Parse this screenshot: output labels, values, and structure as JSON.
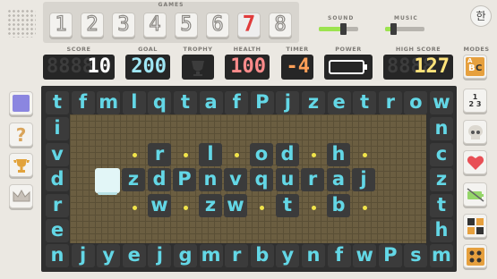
{
  "header": {
    "games_label": "GAMES",
    "games": [
      "1",
      "2",
      "3",
      "4",
      "5",
      "6",
      "7",
      "8"
    ],
    "active_game": "7",
    "sound_label": "SOUND",
    "music_label": "MUSIC",
    "sound_level": 0.62,
    "music_level": 0.2,
    "lang_button": "한"
  },
  "stats": {
    "score": {
      "label": "SCORE",
      "value": "10",
      "ghost": "8888",
      "color": "#ffffff"
    },
    "goal": {
      "label": "GOAL",
      "value": "200",
      "ghost": "888",
      "color": "#9fe7f5"
    },
    "trophy": {
      "label": "TROPHY"
    },
    "health": {
      "label": "HEALTH",
      "value": "100",
      "ghost": "888",
      "color": "#ff8b8b"
    },
    "timer": {
      "label": "TIMER",
      "value": "-4",
      "ghost": "88",
      "color": "#ff9f57"
    },
    "power": {
      "label": "POWER",
      "level": 0
    },
    "high_score": {
      "label": "HIGH SCORE",
      "value": "127",
      "ghost": "8888",
      "color": "#ffe37a"
    },
    "modes_label": "MODES"
  },
  "left_buttons": [
    "square-icon",
    "question-icon",
    "trophy-icon",
    "crown-icon"
  ],
  "right_buttons": [
    "modes-abc-icon",
    "numbers-123-icon",
    "skull-icon",
    "heart-icon",
    "battery-icon",
    "grid-mode-icon",
    "dots-mode-icon"
  ],
  "board": {
    "top_row": [
      "t",
      "f",
      "m",
      "l",
      "q",
      "t",
      "a",
      "f",
      "P",
      "j",
      "z",
      "e",
      "t",
      "r",
      "o",
      "w"
    ],
    "bottom_row": [
      "n",
      "j",
      "y",
      "e",
      "j",
      "g",
      "m",
      "r",
      "b",
      "y",
      "n",
      "f",
      "w",
      "P",
      "s",
      "m"
    ],
    "left_col": [
      "i",
      "v",
      "d",
      "r",
      "e"
    ],
    "right_col": [
      "n",
      "c",
      "z",
      "t",
      "h"
    ],
    "inner": {
      "row1": [
        "r",
        "l",
        "o",
        "d",
        "h"
      ],
      "row2": [
        "z",
        "d",
        "P",
        "n",
        "v",
        "q",
        "u",
        "r",
        "a",
        "j"
      ],
      "row3": [
        "w",
        "z",
        "w",
        "t",
        "b"
      ]
    }
  }
}
